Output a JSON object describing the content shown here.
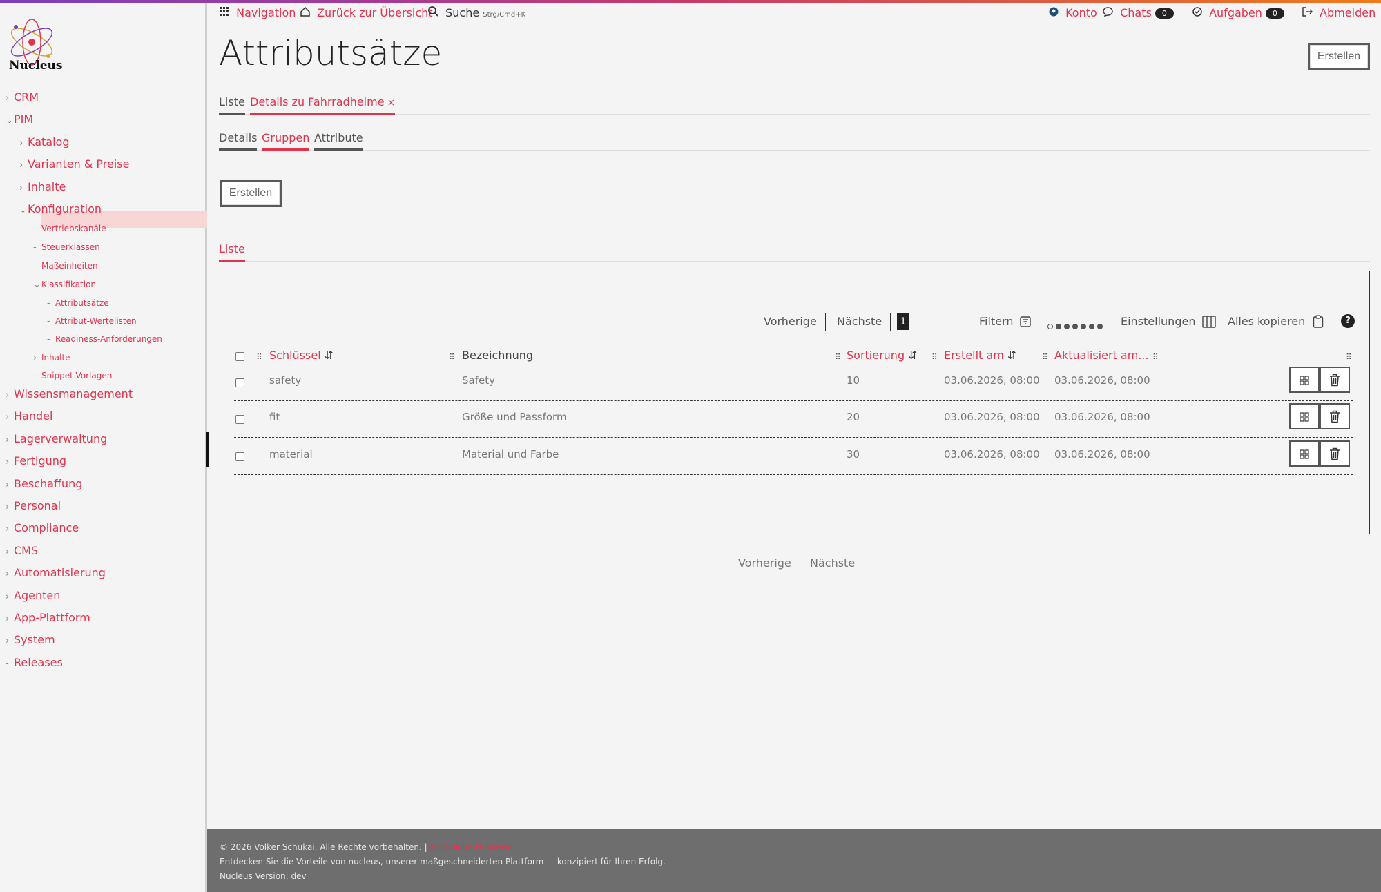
{
  "brand": {
    "name": "Nucleus"
  },
  "header": {
    "navigation": "Navigation",
    "back": "Zurück zur Übersicht",
    "search": "Suche",
    "search_shortcut": "Strg/Cmd+K",
    "account": "Konto",
    "chats": "Chats",
    "chats_count": "0",
    "tasks": "Aufgaben",
    "tasks_count": "0",
    "logout": "Abmelden"
  },
  "sidebar": {
    "items": [
      {
        "label": "CRM",
        "chev": "›"
      },
      {
        "label": "PIM",
        "chev": "⌄"
      },
      {
        "label": "Katalog",
        "chev": "›"
      },
      {
        "label": "Varianten & Preise",
        "chev": "›"
      },
      {
        "label": "Inhalte",
        "chev": "›"
      },
      {
        "label": "Konfiguration",
        "chev": "⌄"
      },
      {
        "label": "Vertriebskanäle",
        "chev": "-"
      },
      {
        "label": "Steuerklassen",
        "chev": "-"
      },
      {
        "label": "Maßeinheiten",
        "chev": "-"
      },
      {
        "label": "Klassifikation",
        "chev": "⌄"
      },
      {
        "label": "Attributsätze",
        "chev": "-"
      },
      {
        "label": "Attribut-Wertelisten",
        "chev": "-"
      },
      {
        "label": "Readiness-Anforderungen",
        "chev": "-"
      },
      {
        "label": "Inhalte",
        "chev": "›"
      },
      {
        "label": "Snippet-Vorlagen",
        "chev": "-"
      },
      {
        "label": "Wissensmanagement",
        "chev": "›"
      },
      {
        "label": "Handel",
        "chev": "›"
      },
      {
        "label": "Lagerverwaltung",
        "chev": "›"
      },
      {
        "label": "Fertigung",
        "chev": "›"
      },
      {
        "label": "Beschaffung",
        "chev": "›"
      },
      {
        "label": "Personal",
        "chev": "›"
      },
      {
        "label": "Compliance",
        "chev": "›"
      },
      {
        "label": "CMS",
        "chev": "›"
      },
      {
        "label": "Automatisierung",
        "chev": "›"
      },
      {
        "label": "Agenten",
        "chev": "›"
      },
      {
        "label": "App-Plattform",
        "chev": "›"
      },
      {
        "label": "System",
        "chev": "›"
      },
      {
        "label": "Releases",
        "chev": "-"
      }
    ]
  },
  "page": {
    "title": "Attributsätze",
    "create": "Erstellen",
    "tabs": [
      "Liste",
      "Details zu Fahrradhelme"
    ],
    "tab_close": "×",
    "subtabs": [
      "Details",
      "Gruppen",
      "Attribute"
    ],
    "group_create": "Erstellen",
    "list_tab": "Liste"
  },
  "table": {
    "prev": "Vorherige",
    "next": "Nächste",
    "page": "1",
    "filter": "Filtern",
    "settings": "Einstellungen",
    "copy_all": "Alles kopieren",
    "help": "?",
    "columns": [
      "Schlüssel",
      "Bezeichnung",
      "Sortierung",
      "Erstellt am",
      "Aktualisiert am..."
    ],
    "rows": [
      {
        "key": "safety",
        "name": "Safety",
        "sort": "10",
        "created": "03.06.2026, 08:00",
        "updated": "03.06.2026, 08:00"
      },
      {
        "key": "fit",
        "name": "Größe und Passform",
        "sort": "20",
        "created": "03.06.2026, 08:00",
        "updated": "03.06.2026, 08:00"
      },
      {
        "key": "material",
        "name": "Material und Farbe",
        "sort": "30",
        "created": "03.06.2026, 08:00",
        "updated": "03.06.2026, 08:00"
      }
    ],
    "bottom_prev": "Vorherige",
    "bottom_next": "Nächste"
  },
  "footer": {
    "copyright": "© 2026 Volker Schukai. Alle Rechte vorbehalten. |",
    "legal": "Rechtliche Hinweise",
    "tagline": "Entdecken Sie die Vorteile von nucleus, unserer maßgeschneiderten Plattform — konzipiert für Ihren Erfolg.",
    "version": "Nucleus Version: dev"
  }
}
